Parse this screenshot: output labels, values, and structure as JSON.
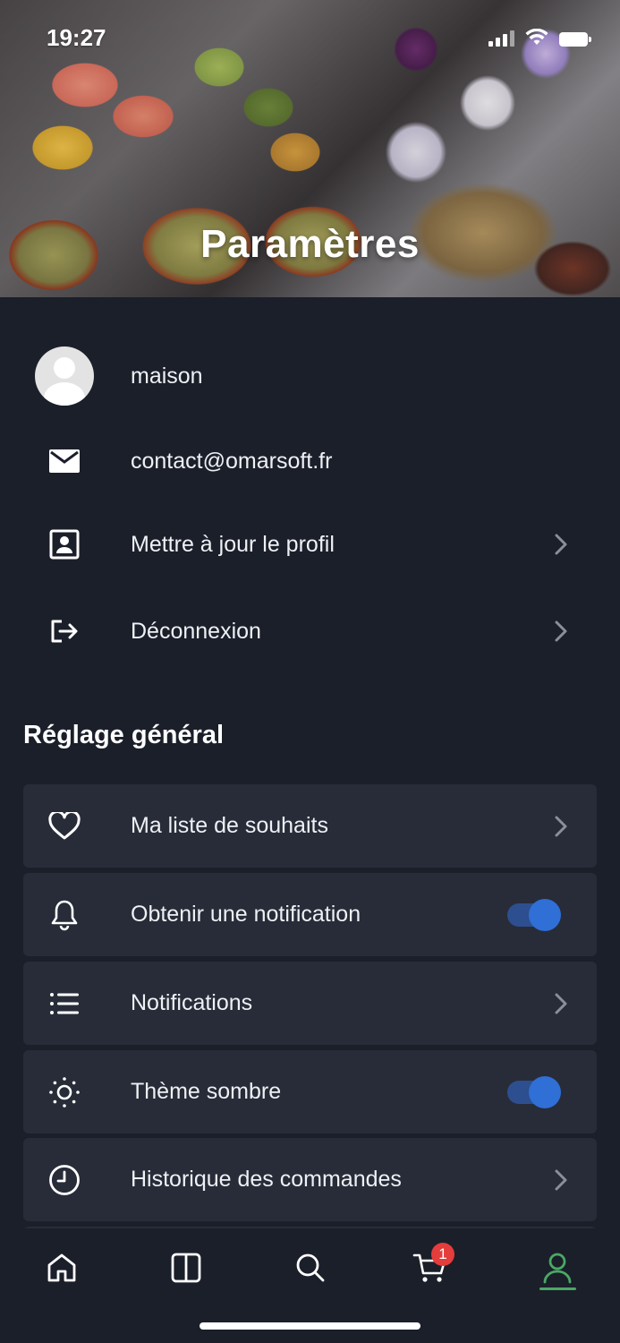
{
  "status_bar": {
    "time": "19:27"
  },
  "header": {
    "title": "Paramètres"
  },
  "account": {
    "username": "maison",
    "email": "contact@omarsoft.fr",
    "update_profile_label": "Mettre à jour le profil",
    "logout_label": "Déconnexion"
  },
  "general_settings": {
    "title": "Réglage général",
    "items": [
      {
        "label": "Ma liste de souhaits",
        "icon": "heart-icon",
        "control": "chevron"
      },
      {
        "label": "Obtenir une notification",
        "icon": "bell-icon",
        "control": "toggle",
        "enabled": true
      },
      {
        "label": "Notifications",
        "icon": "list-icon",
        "control": "chevron"
      },
      {
        "label": "Thème sombre",
        "icon": "sun-icon",
        "control": "toggle",
        "enabled": true
      },
      {
        "label": "Historique des commandes",
        "icon": "clock-icon",
        "control": "chevron"
      }
    ]
  },
  "bottom_nav": {
    "items": [
      "home-icon",
      "categories-icon",
      "search-icon",
      "cart-icon",
      "profile-icon"
    ],
    "active": "profile-icon",
    "cart_count": "1"
  },
  "colors": {
    "background": "#1b1f2a",
    "card": "#272c38",
    "toggle_accent": "#2f6fd6",
    "active_nav": "#4aa865",
    "badge": "#e53c3c"
  }
}
